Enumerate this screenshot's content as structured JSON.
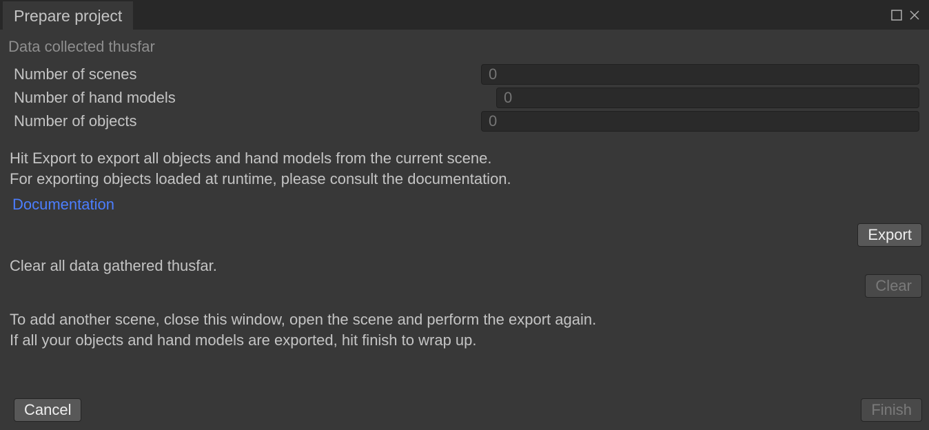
{
  "tab": {
    "label": "Prepare project"
  },
  "section": {
    "heading": "Data collected thusfar"
  },
  "fields": {
    "scenes": {
      "label": "Number of scenes",
      "value": "0"
    },
    "handModels": {
      "label": "Number of hand models",
      "value": "0"
    },
    "objects": {
      "label": "Number of objects",
      "value": "0"
    }
  },
  "helpText": "Hit Export to export all objects and hand models from the current scene.\nFor exporting objects loaded at runtime, please consult the documentation.",
  "docLink": "Documentation",
  "clearText": "Clear all data gathered thusfar.",
  "addSceneText": "To add another scene, close this window, open the scene and perform the export again.\nIf all your objects and hand models are exported, hit finish to wrap up.",
  "buttons": {
    "export": "Export",
    "clear": "Clear",
    "cancel": "Cancel",
    "finish": "Finish"
  }
}
